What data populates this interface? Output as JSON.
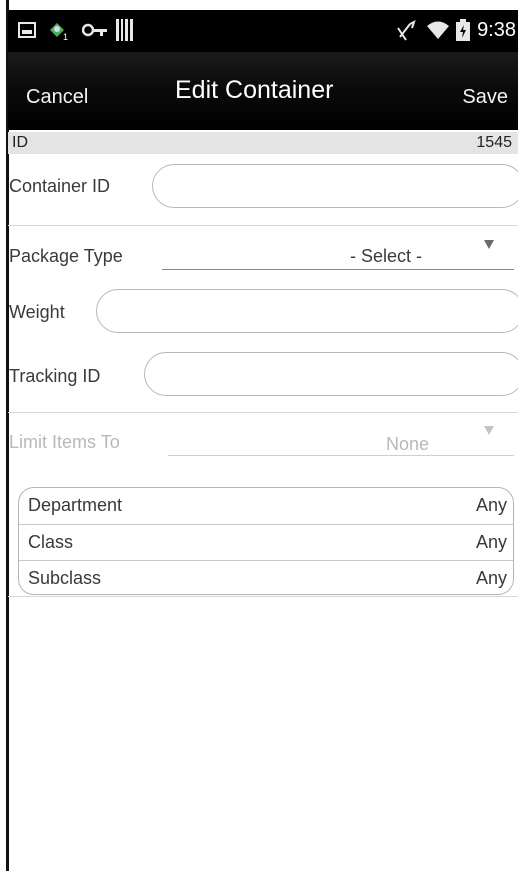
{
  "status_bar": {
    "time": "9:38",
    "icons": [
      "image-icon",
      "location-badge-icon",
      "key-icon",
      "barcode-icon",
      "mute-icon",
      "wifi-icon",
      "battery-icon"
    ]
  },
  "action_bar": {
    "cancel_label": "Cancel",
    "title": "Edit Container",
    "save_label": "Save"
  },
  "id_row": {
    "label": "ID",
    "value": "1545"
  },
  "form": {
    "container_id": {
      "label": "Container ID",
      "value": ""
    },
    "package_type": {
      "label": "Package Type",
      "selected": "- Select -"
    },
    "weight": {
      "label": "Weight",
      "value": ""
    },
    "tracking_id": {
      "label": "Tracking ID",
      "value": ""
    },
    "limit_items_to": {
      "label": "Limit Items To",
      "selected": "None",
      "disabled": true
    }
  },
  "filters": [
    {
      "label": "Department",
      "value": "Any"
    },
    {
      "label": "Class",
      "value": "Any"
    },
    {
      "label": "Subclass",
      "value": "Any"
    }
  ],
  "colors": {
    "status_bar_bg": "#000000",
    "action_bar_bg": "#0b0b0b",
    "id_row_bg": "#e4e4e4",
    "disabled_text": "#b9b9b9"
  }
}
